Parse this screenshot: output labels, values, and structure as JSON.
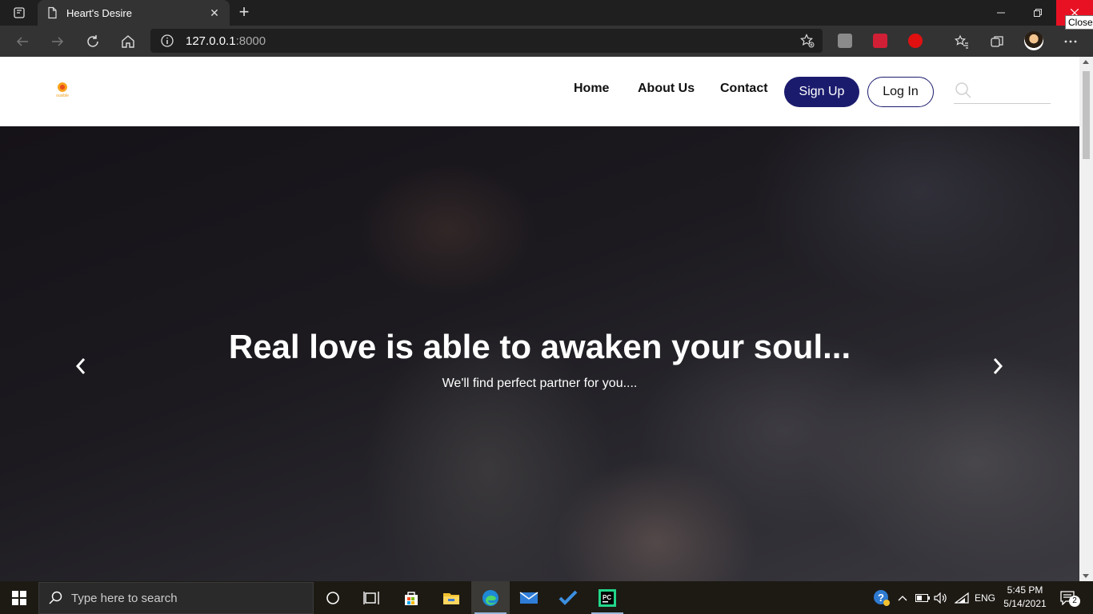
{
  "browser": {
    "tab_title": "Heart's Desire",
    "address_host": "127.0.0.1",
    "address_port": ":8000",
    "tooltip": "Close"
  },
  "site": {
    "logo_text": "ousible",
    "nav": {
      "home": "Home",
      "about": "About Us",
      "contact": "Contact"
    },
    "signup_label": "Sign Up",
    "login_label": "Log In",
    "search_placeholder": ""
  },
  "hero": {
    "title": "Real love is able to awaken your soul...",
    "subtitle": "We'll find perfect partner for you...."
  },
  "taskbar": {
    "search_placeholder": "Type here to search",
    "language": "ENG",
    "time": "5:45 PM",
    "date": "5/14/2021",
    "notification_count": "2"
  },
  "colors": {
    "brand_navy": "#1b1b6e",
    "close_red": "#e81123"
  }
}
